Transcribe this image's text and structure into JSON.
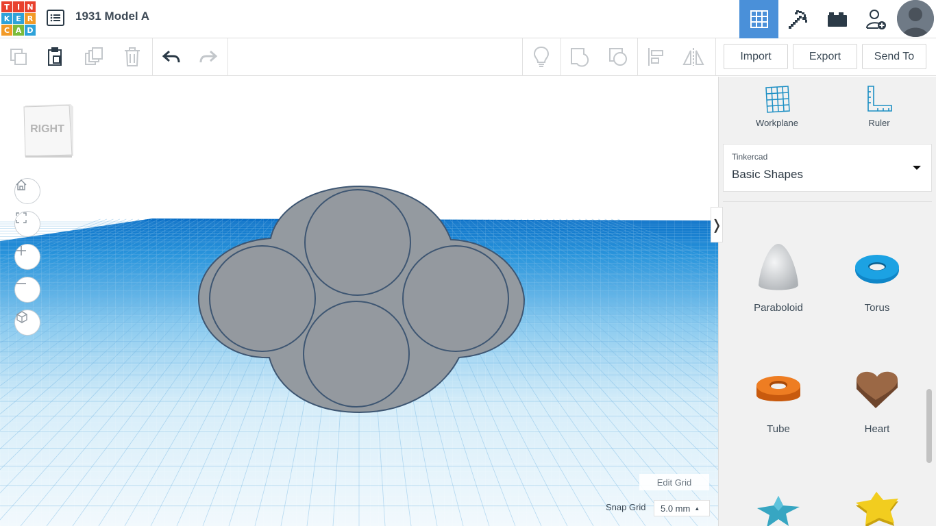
{
  "app": {
    "logo_letters": [
      "T",
      "I",
      "N",
      "K",
      "E",
      "R",
      "C",
      "A",
      "D"
    ],
    "logo_colors": [
      "#e8412e",
      "#e8412e",
      "#e8412e",
      "#2ea2d9",
      "#2ea2d9",
      "#f29a27",
      "#f29a27",
      "#7bbb3a",
      "#2ea2d9"
    ],
    "document_title": "1931 Model A",
    "accent_color": "#4a90d9"
  },
  "header": {
    "view_buttons": [
      "grid-view-icon",
      "pickaxe-icon",
      "bricks-icon",
      "add-user-icon"
    ],
    "active_view": "grid-view-icon"
  },
  "toolbar": {
    "edit_icons": [
      "copy-icon",
      "paste-icon",
      "duplicate-icon",
      "delete-icon",
      "undo-icon",
      "redo-icon"
    ],
    "tool_icons": [
      "lightbulb-icon",
      "group-icon",
      "ungroup-icon",
      "align-icon",
      "mirror-icon"
    ],
    "import_label": "Import",
    "export_label": "Export",
    "sendto_label": "Send To"
  },
  "viewport": {
    "viewcube_label": "RIGHT",
    "nav_icons": [
      "home-icon",
      "fit-view-icon",
      "zoom-in-icon",
      "zoom-out-icon",
      "perspective-icon"
    ],
    "edit_grid_label": "Edit Grid",
    "snap_grid_label": "Snap Grid",
    "snap_grid_value": "5.0 mm",
    "workplane_color": "#0b7bd1",
    "shape_color": "#9aa0a6"
  },
  "panel": {
    "workplane_label": "Workplane",
    "ruler_label": "Ruler",
    "library_source": "Tinkercad",
    "library_name": "Basic Shapes",
    "shapes": [
      {
        "label": "Paraboloid",
        "color": "#d7d9db"
      },
      {
        "label": "Torus",
        "color": "#1a8fd1"
      },
      {
        "label": "Tube",
        "color": "#e06b16"
      },
      {
        "label": "Heart",
        "color": "#8b5a3c"
      },
      {
        "label": "",
        "color": "#3fb1c9"
      },
      {
        "label": "",
        "color": "#f0c81f"
      }
    ]
  }
}
